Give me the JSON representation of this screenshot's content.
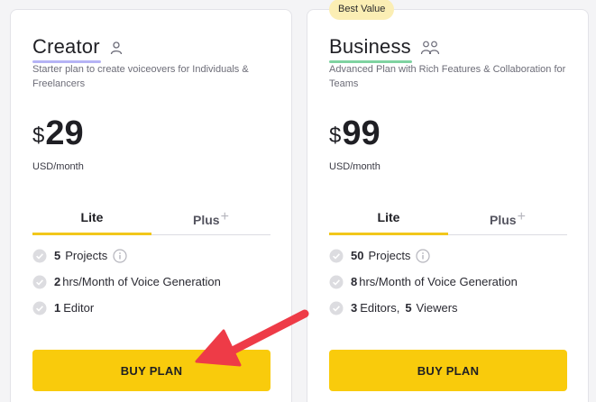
{
  "plans": [
    {
      "name": "Creator",
      "icon": "user-icon",
      "description": "Starter plan to create voiceovers for Individuals & Freelancers",
      "currency": "$",
      "price": "29",
      "period": "USD/month",
      "tabs": {
        "lite": "Lite",
        "plus": "Plus",
        "plus_sign": "+"
      },
      "features": [
        {
          "num": "5",
          "text": "Projects"
        },
        {
          "num": "2",
          "text": "hrs/Month of Voice Generation"
        },
        {
          "num": "1",
          "text": "Editor"
        }
      ],
      "button": "BUY PLAN"
    },
    {
      "badge": "Best Value",
      "name": "Business",
      "icon": "users-icon",
      "description": "Advanced Plan with Rich Features & Collaboration for Teams",
      "currency": "$",
      "price": "99",
      "period": "USD/month",
      "tabs": {
        "lite": "Lite",
        "plus": "Plus",
        "plus_sign": "+"
      },
      "features": [
        {
          "num": "50",
          "text": "Projects"
        },
        {
          "num": "8",
          "text": "hrs/Month of Voice Generation"
        },
        {
          "num": "3",
          "text": "Editors,",
          "num2": "5",
          "text2": "Viewers"
        }
      ],
      "button": "BUY PLAN"
    }
  ],
  "colors": {
    "accent_yellow": "#f9cb0c",
    "tab_underline": "#f2c71b",
    "creator_underline": "#b5b3f5",
    "business_underline": "#7fd3a1",
    "badge_bg": "#fbeeb4",
    "annotation_arrow": "#ee3b47"
  }
}
